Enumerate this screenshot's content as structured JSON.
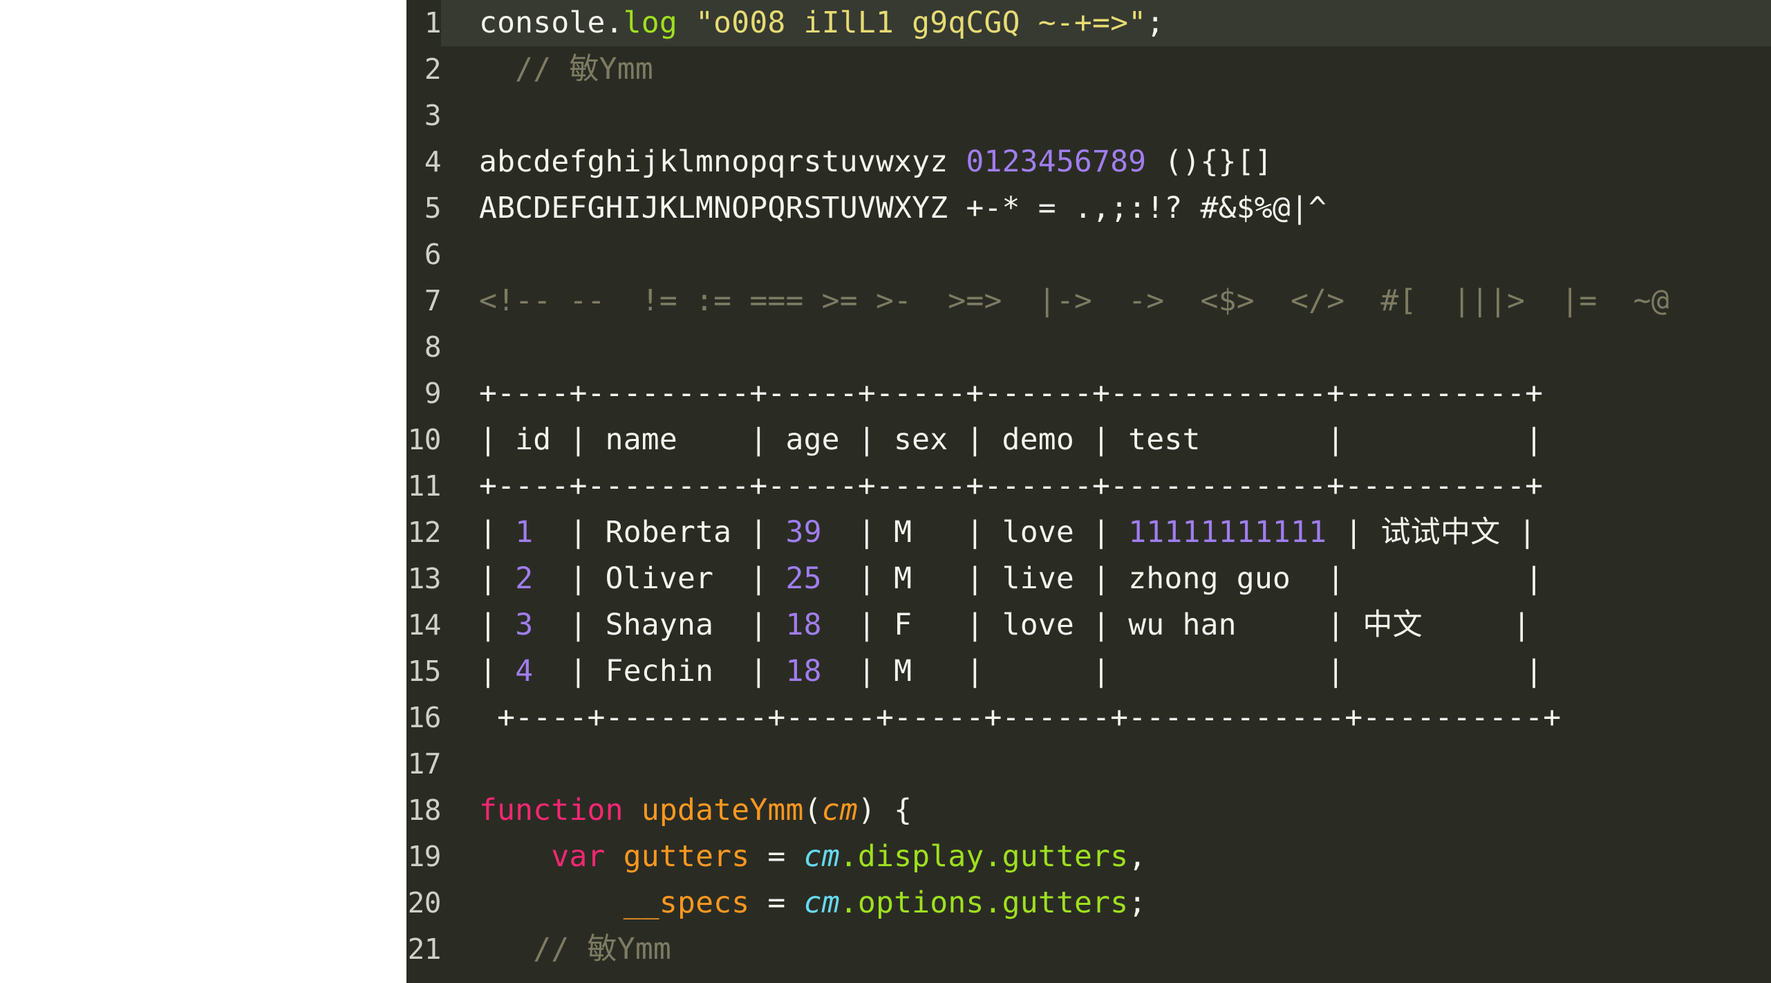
{
  "editor": {
    "theme_name": "monokai-dark",
    "colors": {
      "background": "#2a2c24",
      "active_line": "#373a31",
      "gutter_text": "#cfd0c8",
      "foreground": "#f4f5ee",
      "string": "#e6db74",
      "comment": "#7d7c63",
      "number": "#a07ef0",
      "keyword": "#f92672",
      "variable": "#fd971f",
      "function": "#9fe01e",
      "cyan": "#66d9ef",
      "page_margin": "#ffffff"
    },
    "active_line_number": 1,
    "lines": [
      {
        "number": "1",
        "active": true,
        "tokens": [
          {
            "text": "console.",
            "cls": "t-plain"
          },
          {
            "text": "log",
            "cls": "t-fn"
          },
          {
            "text": " ",
            "cls": "t-plain"
          },
          {
            "text": "\"o008 iIlL1 g9qCGQ ~-+=>\"",
            "cls": "t-string"
          },
          {
            "text": ";",
            "cls": "t-plain"
          }
        ]
      },
      {
        "number": "2",
        "active": false,
        "tokens": [
          {
            "text": "  // ",
            "cls": "t-comment"
          },
          {
            "text": "敏",
            "cls": "t-comment t-cjk"
          },
          {
            "text": "Ymm",
            "cls": "t-comment"
          }
        ]
      },
      {
        "number": "3",
        "active": false,
        "tokens": []
      },
      {
        "number": "4",
        "active": false,
        "tokens": [
          {
            "text": "abcdefghijklmnopqrstuvwxyz ",
            "cls": "t-plain"
          },
          {
            "text": "0123456789",
            "cls": "t-number"
          },
          {
            "text": " (){}[]",
            "cls": "t-plain"
          }
        ]
      },
      {
        "number": "5",
        "active": false,
        "tokens": [
          {
            "text": "ABCDEFGHIJKLMNOPQRSTUVWXYZ +-* = .,;:!? #&$%@|^",
            "cls": "t-plain"
          }
        ]
      },
      {
        "number": "6",
        "active": false,
        "tokens": []
      },
      {
        "number": "7",
        "active": false,
        "tokens": [
          {
            "text": "<!-- --  != := === >= >-  >=>  |->  ->  <$>  </>  #[  |||>  |=  ~@",
            "cls": "t-comment"
          }
        ]
      },
      {
        "number": "8",
        "active": false,
        "tokens": []
      },
      {
        "number": "9",
        "active": false,
        "tokens": [
          {
            "text": "+----+---------+-----+-----+------+------------+----------+",
            "cls": "t-plain"
          }
        ]
      },
      {
        "number": "10",
        "active": false,
        "tokens": [
          {
            "text": "| id | name    | age | sex | demo | test       |          |",
            "cls": "t-plain"
          }
        ]
      },
      {
        "number": "11",
        "active": false,
        "tokens": [
          {
            "text": "+----+---------+-----+-----+------+------------+----------+",
            "cls": "t-plain"
          }
        ]
      },
      {
        "number": "12",
        "active": false,
        "tokens": [
          {
            "text": "| ",
            "cls": "t-plain"
          },
          {
            "text": "1",
            "cls": "t-number"
          },
          {
            "text": "  | Roberta | ",
            "cls": "t-plain"
          },
          {
            "text": "39",
            "cls": "t-number"
          },
          {
            "text": "  | M   | love | ",
            "cls": "t-plain"
          },
          {
            "text": "11111111111",
            "cls": "t-number"
          },
          {
            "text": " | ",
            "cls": "t-plain"
          },
          {
            "text": "试试中文",
            "cls": "t-plain t-cjk"
          },
          {
            "text": " |",
            "cls": "t-plain"
          }
        ]
      },
      {
        "number": "13",
        "active": false,
        "tokens": [
          {
            "text": "| ",
            "cls": "t-plain"
          },
          {
            "text": "2",
            "cls": "t-number"
          },
          {
            "text": "  | Oliver  | ",
            "cls": "t-plain"
          },
          {
            "text": "25",
            "cls": "t-number"
          },
          {
            "text": "  | M   | live | zhong guo  |          |",
            "cls": "t-plain"
          }
        ]
      },
      {
        "number": "14",
        "active": false,
        "tokens": [
          {
            "text": "| ",
            "cls": "t-plain"
          },
          {
            "text": "3",
            "cls": "t-number"
          },
          {
            "text": "  | Shayna  | ",
            "cls": "t-plain"
          },
          {
            "text": "18",
            "cls": "t-number"
          },
          {
            "text": "  | F   | love | wu han     | ",
            "cls": "t-plain"
          },
          {
            "text": "中文",
            "cls": "t-plain t-cjk"
          },
          {
            "text": "     |",
            "cls": "t-plain"
          }
        ]
      },
      {
        "number": "15",
        "active": false,
        "tokens": [
          {
            "text": "| ",
            "cls": "t-plain"
          },
          {
            "text": "4",
            "cls": "t-number"
          },
          {
            "text": "  | Fechin  | ",
            "cls": "t-plain"
          },
          {
            "text": "18",
            "cls": "t-number"
          },
          {
            "text": "  | M   |      |            |          |",
            "cls": "t-plain"
          }
        ]
      },
      {
        "number": "16",
        "active": false,
        "tokens": [
          {
            "text": " +----+---------+-----+-----+------+------------+----------+",
            "cls": "t-plain"
          }
        ]
      },
      {
        "number": "17",
        "active": false,
        "tokens": []
      },
      {
        "number": "18",
        "active": false,
        "tokens": [
          {
            "text": "function",
            "cls": "t-keyword"
          },
          {
            "text": " ",
            "cls": "t-plain"
          },
          {
            "text": "updateYmm",
            "cls": "t-var"
          },
          {
            "text": "(",
            "cls": "t-punct"
          },
          {
            "text": "cm",
            "cls": "t-param"
          },
          {
            "text": ") {",
            "cls": "t-punct"
          }
        ]
      },
      {
        "number": "19",
        "active": false,
        "tokens": [
          {
            "text": "    ",
            "cls": "t-plain"
          },
          {
            "text": "var",
            "cls": "t-keyword"
          },
          {
            "text": " ",
            "cls": "t-plain"
          },
          {
            "text": "gutters",
            "cls": "t-var"
          },
          {
            "text": " = ",
            "cls": "t-punct"
          },
          {
            "text": "cm",
            "cls": "t-cyan"
          },
          {
            "text": ".",
            "cls": "t-prop"
          },
          {
            "text": "display",
            "cls": "t-prop"
          },
          {
            "text": ".",
            "cls": "t-prop"
          },
          {
            "text": "gutters",
            "cls": "t-prop"
          },
          {
            "text": ",",
            "cls": "t-punct"
          }
        ]
      },
      {
        "number": "20",
        "active": false,
        "tokens": [
          {
            "text": "        ",
            "cls": "t-plain"
          },
          {
            "text": "__specs",
            "cls": "t-var"
          },
          {
            "text": " = ",
            "cls": "t-punct"
          },
          {
            "text": "cm",
            "cls": "t-cyan"
          },
          {
            "text": ".",
            "cls": "t-prop"
          },
          {
            "text": "options",
            "cls": "t-prop"
          },
          {
            "text": ".",
            "cls": "t-prop"
          },
          {
            "text": "gutters",
            "cls": "t-prop"
          },
          {
            "text": ";",
            "cls": "t-punct"
          }
        ]
      },
      {
        "number": "21",
        "active": false,
        "tokens": [
          {
            "text": "   // ",
            "cls": "t-comment"
          },
          {
            "text": "敏",
            "cls": "t-comment t-cjk"
          },
          {
            "text": "Ymm",
            "cls": "t-comment"
          }
        ]
      }
    ]
  }
}
